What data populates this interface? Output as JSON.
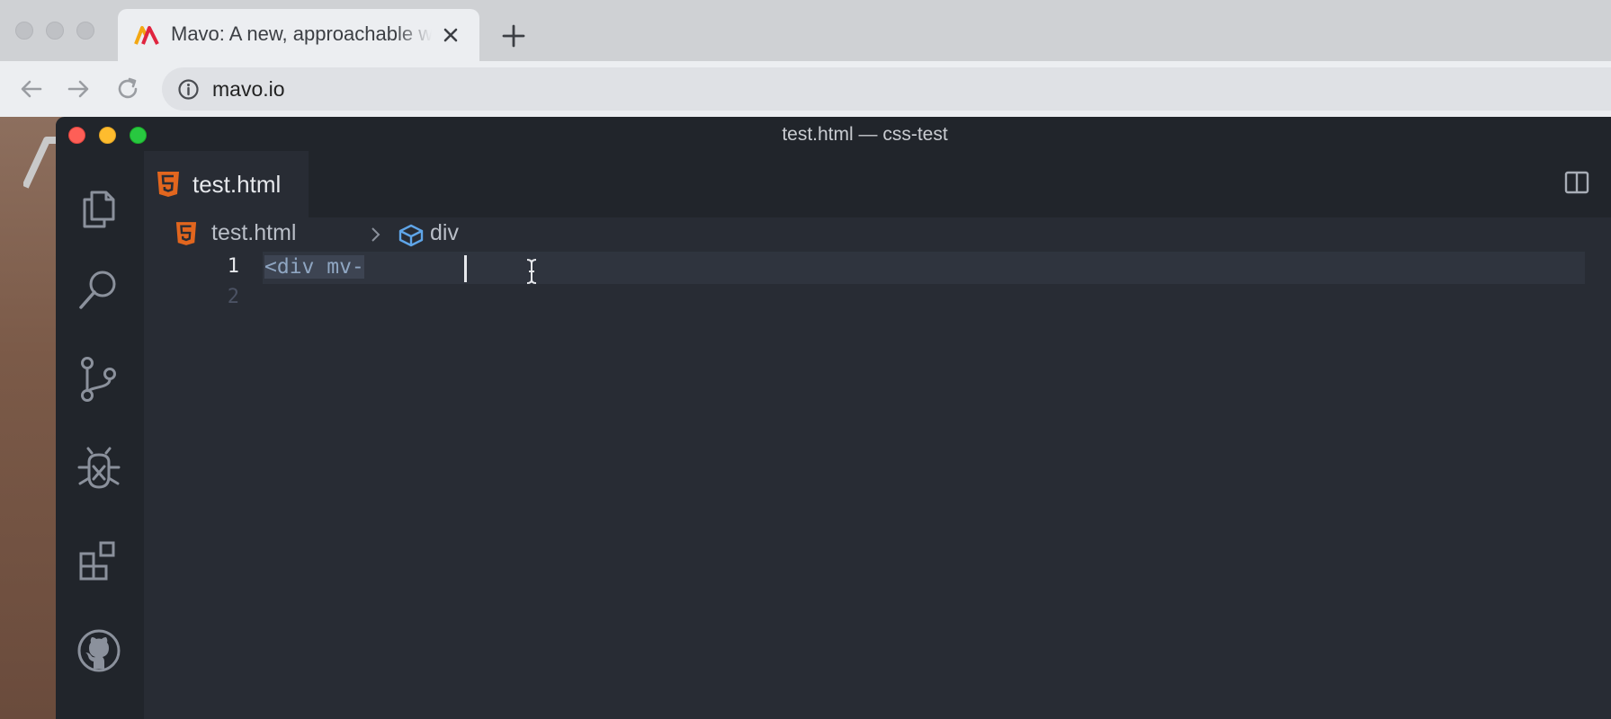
{
  "browser": {
    "tab": {
      "title": "Mavo: A new, approachable way to create web apps"
    },
    "address": {
      "url": "mavo.io"
    },
    "icons": [
      "back-icon",
      "forward-icon",
      "reload-icon",
      "info-icon",
      "new-tab-icon",
      "close-icon"
    ]
  },
  "vscode": {
    "window_title": "test.html — css-test",
    "activity_bar": [
      "explorer-icon",
      "search-icon",
      "source-control-icon",
      "debug-icon",
      "extensions-icon",
      "github-icon"
    ],
    "editor_tab": {
      "label": "test.html"
    },
    "breadcrumbs": {
      "file": "test.html",
      "symbol": "div"
    },
    "lines": [
      {
        "number": "1",
        "text": "<div mv-"
      },
      {
        "number": "2",
        "text": ""
      }
    ]
  },
  "colors": {
    "editor_bg": "#282c34",
    "sidebar_bg": "#21252b",
    "html_icon": "#e2661e",
    "symbol_icon": "#5fa5e8",
    "mac_close": "#fe5f57",
    "mac_min": "#febc2e",
    "mac_max": "#28c840"
  }
}
